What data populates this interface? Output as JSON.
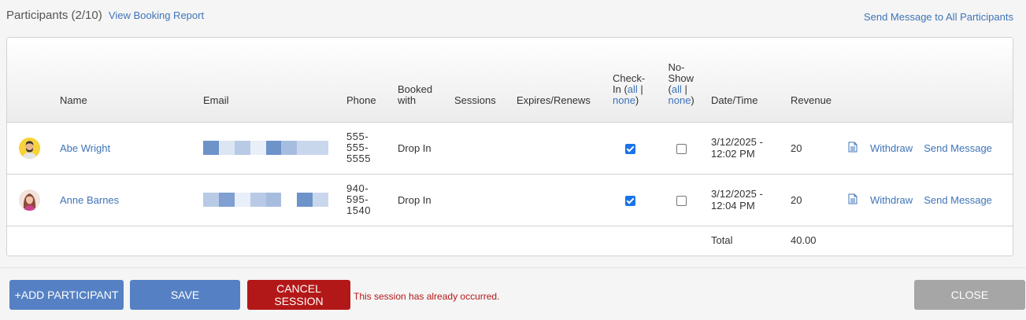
{
  "header": {
    "title": "Participants",
    "count": "(2/10)",
    "view_report_link": "View Booking Report",
    "send_all_link": "Send Message to All Participants"
  },
  "table": {
    "columns": {
      "name": "Name",
      "email": "Email",
      "phone": "Phone",
      "booked_with": "Booked with",
      "sessions": "Sessions",
      "expires": "Expires/Renews",
      "checkin_label": "Check-In",
      "checkin_all": "all",
      "checkin_none": "none",
      "noshow_label": "No-Show",
      "noshow_all": "all",
      "noshow_none": "none",
      "datetime": "Date/Time",
      "revenue": "Revenue"
    },
    "rows": [
      {
        "name": "Abe Wright",
        "phone": "555-555-5555",
        "booked_with": "Drop In",
        "sessions": "",
        "expires": "",
        "checked_in": true,
        "no_show": false,
        "datetime": "3/12/2025 - 12:02 PM",
        "revenue": "20",
        "withdraw": "Withdraw",
        "send_message": "Send Message"
      },
      {
        "name": "Anne Barnes",
        "phone": "940-595-1540",
        "booked_with": "Drop In",
        "sessions": "",
        "expires": "",
        "checked_in": true,
        "no_show": false,
        "datetime": "3/12/2025 - 12:04 PM",
        "revenue": "20",
        "withdraw": "Withdraw",
        "send_message": "Send Message"
      }
    ],
    "total_label": "Total",
    "total_value": "40.00"
  },
  "footer": {
    "add_participant": "+ADD PARTICIPANT",
    "save": "SAVE",
    "cancel_session": "CANCEL SESSION",
    "warning": "This session has already occurred.",
    "close": "CLOSE"
  },
  "colors": {
    "link": "#3f74b8",
    "primary_button": "#5581c4",
    "danger": "#b31818",
    "close_button": "#a6a6a6",
    "checkbox_checked": "#1a73e8"
  },
  "icons": {
    "row_detail": "document-icon",
    "avatar_1": "male-avatar-icon",
    "avatar_2": "female-avatar-icon"
  }
}
